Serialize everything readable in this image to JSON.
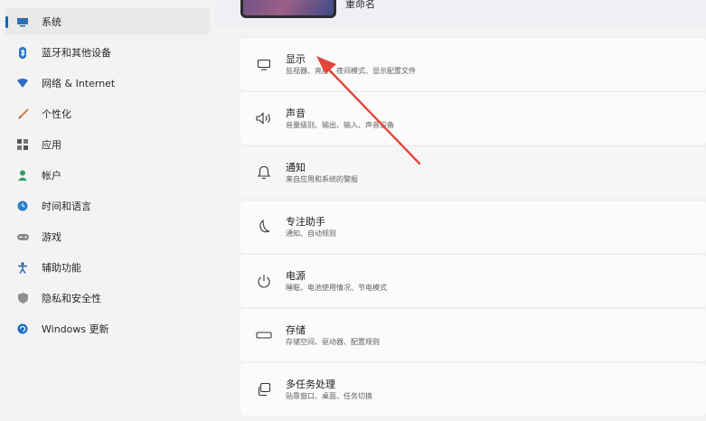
{
  "sidebar": {
    "items": [
      {
        "label": "系统",
        "icon": "monitor-icon"
      },
      {
        "label": "蓝牙和其他设备",
        "icon": "bluetooth-icon"
      },
      {
        "label": "网络 & Internet",
        "icon": "wifi-icon"
      },
      {
        "label": "个性化",
        "icon": "brush-icon"
      },
      {
        "label": "应用",
        "icon": "apps-icon"
      },
      {
        "label": "帐户",
        "icon": "person-icon"
      },
      {
        "label": "时间和语言",
        "icon": "globe-clock-icon"
      },
      {
        "label": "游戏",
        "icon": "gamepad-icon"
      },
      {
        "label": "辅助功能",
        "icon": "accessibility-icon"
      },
      {
        "label": "隐私和安全性",
        "icon": "shield-icon"
      },
      {
        "label": "Windows 更新",
        "icon": "update-icon"
      }
    ],
    "active_index": 0
  },
  "header": {
    "rename_label": "重命名"
  },
  "settings": [
    {
      "title": "显示",
      "subtitle": "监视器、亮度、夜间模式、显示配置文件",
      "icon": "display-icon"
    },
    {
      "title": "声音",
      "subtitle": "音量级别、输出、输入、声音设备",
      "icon": "speaker-icon"
    },
    {
      "title": "通知",
      "subtitle": "来自应用和系统的警报",
      "icon": "bell-icon"
    },
    {
      "title": "专注助手",
      "subtitle": "通知、自动规则",
      "icon": "moon-icon"
    },
    {
      "title": "电源",
      "subtitle": "睡眠、电池使用情况、节电模式",
      "icon": "power-icon"
    },
    {
      "title": "存储",
      "subtitle": "存储空间、驱动器、配置规则",
      "icon": "storage-icon"
    },
    {
      "title": "多任务处理",
      "subtitle": "贴靠窗口、桌面、任务切换",
      "icon": "multitask-icon"
    }
  ],
  "colors": {
    "accent": "#0067c0",
    "annotation_arrow": "#e3473c"
  }
}
